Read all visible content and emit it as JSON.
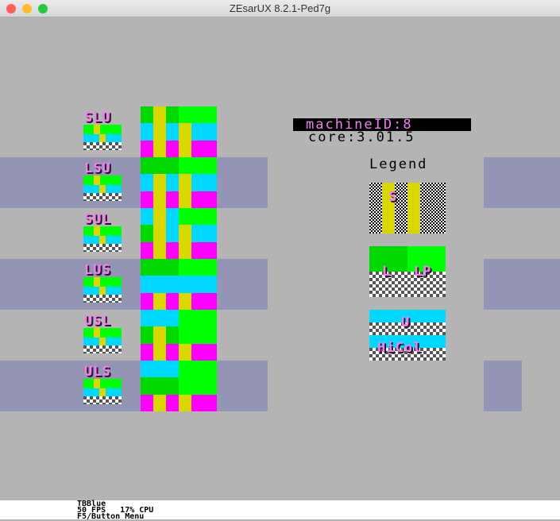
{
  "window": {
    "title": "ZEsarUX 8.2.1-Ped7g"
  },
  "layers": [
    {
      "label": "SLU"
    },
    {
      "label": "LSU"
    },
    {
      "label": "SUL"
    },
    {
      "label": "LUS"
    },
    {
      "label": "USL"
    },
    {
      "label": "ULS"
    }
  ],
  "info": {
    "machine": "machineID:8",
    "core": "core:3.01.5",
    "legend_title": "Legend"
  },
  "legend": {
    "sprites": "S",
    "layer2": "L",
    "layer2_priority": "LP",
    "ula": "U",
    "hicolor": "HiCol"
  },
  "status": {
    "line1": "TBBlue",
    "line2": "50 FPS   17% CPU",
    "line3": "F5/Button Menu"
  },
  "colors": {
    "band": "#9494b4",
    "background": "#b4b4b4",
    "green": "#00ff00",
    "cyan": "#00d8ff",
    "magenta": "#ff00ff",
    "yellow": "#d8d800"
  }
}
